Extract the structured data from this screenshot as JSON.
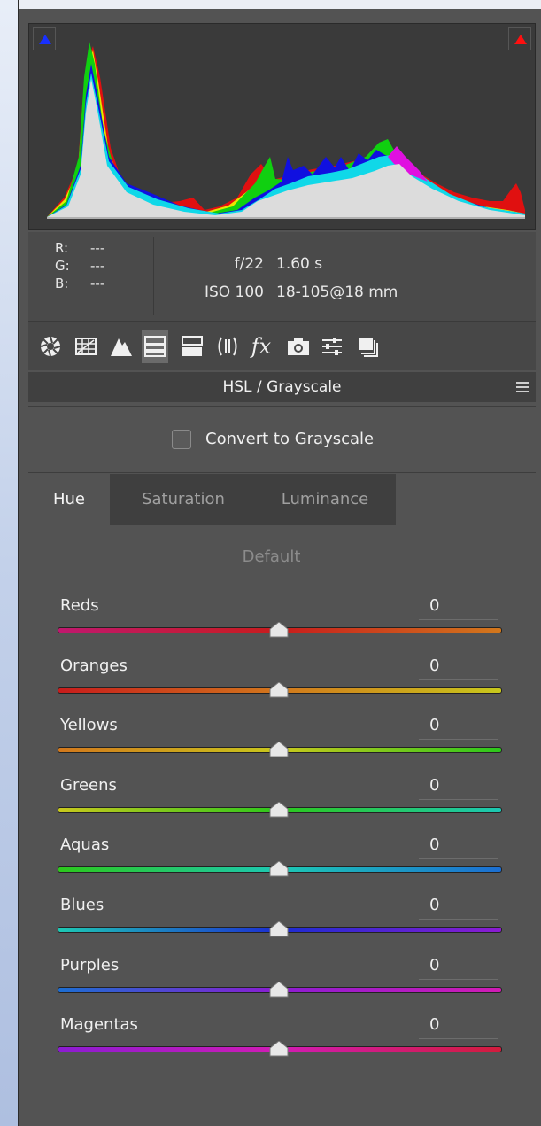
{
  "panel": {
    "info": {
      "r_label": "R:",
      "g_label": "G:",
      "b_label": "B:",
      "r_value": "---",
      "g_value": "---",
      "b_value": "---",
      "aperture": "f/22",
      "shutter": "1.60 s",
      "iso": "ISO 100",
      "lens": "18-105@18 mm"
    },
    "toolbar": {
      "icons": [
        "aperture-icon",
        "grid-icon",
        "mountains-icon",
        "hsl-icon",
        "split-tone-icon",
        "lens-icon",
        "fx-icon",
        "camera-icon",
        "sliders-icon",
        "presets-icon"
      ],
      "active_index": 3
    },
    "section_title": "HSL / Grayscale",
    "grayscale_label": "Convert to Grayscale",
    "grayscale_checked": false,
    "tabs": [
      "Hue",
      "Saturation",
      "Luminance"
    ],
    "active_tab": "Hue",
    "default_link": "Default",
    "sliders": [
      {
        "label": "Reds",
        "value": "0",
        "left": "#c0186e",
        "mid": "#c81c1c",
        "right": "#d2781c"
      },
      {
        "label": "Oranges",
        "value": "0",
        "left": "#c81c1c",
        "mid": "#d2781c",
        "right": "#c8c81c"
      },
      {
        "label": "Yellows",
        "value": "0",
        "left": "#d2781c",
        "mid": "#c8c81c",
        "right": "#2cc81c"
      },
      {
        "label": "Greens",
        "value": "0",
        "left": "#c8c81c",
        "mid": "#2cc81c",
        "right": "#1cc8b4"
      },
      {
        "label": "Aquas",
        "value": "0",
        "left": "#2cc81c",
        "mid": "#1cc8b4",
        "right": "#1c6ed2"
      },
      {
        "label": "Blues",
        "value": "0",
        "left": "#1cc8b4",
        "mid": "#1c2cd2",
        "right": "#8c1cd2"
      },
      {
        "label": "Purples",
        "value": "0",
        "left": "#1c6ed2",
        "mid": "#8c1cd2",
        "right": "#d21cb4"
      },
      {
        "label": "Magentas",
        "value": "0",
        "left": "#8c1cd2",
        "mid": "#d21cb4",
        "right": "#d21c3c"
      }
    ],
    "slider_position": 0.5
  }
}
